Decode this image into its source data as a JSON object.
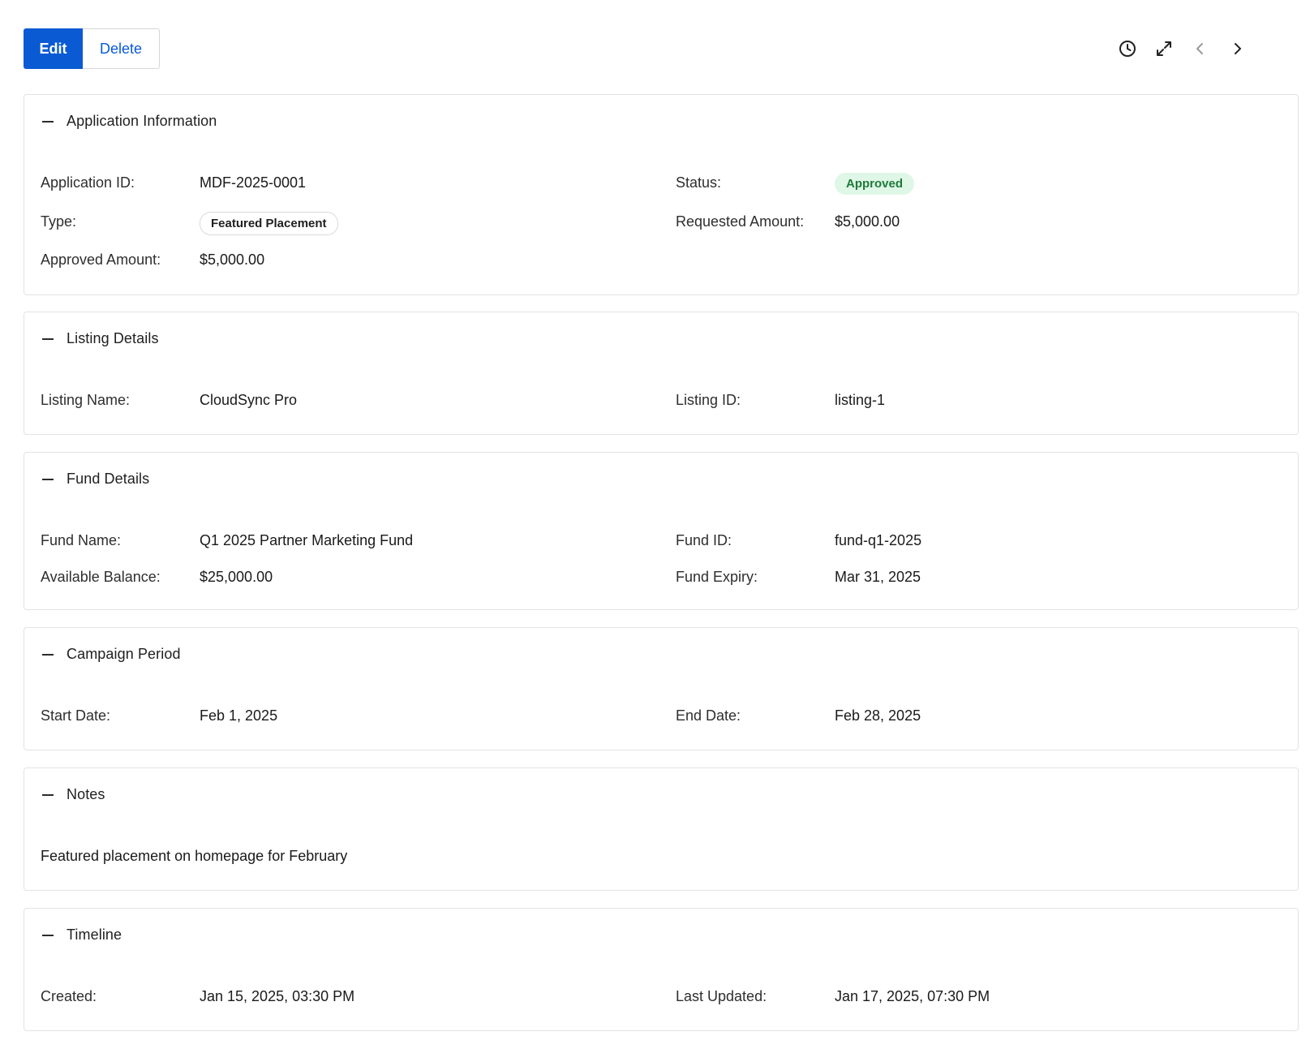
{
  "toolbar": {
    "edit_label": "Edit",
    "delete_label": "Delete",
    "icons": [
      "history-icon",
      "expand-icon",
      "previous-icon",
      "next-icon"
    ]
  },
  "sections": {
    "application": {
      "title": "Application Information",
      "application_id_label": "Application ID:",
      "application_id": "MDF-2025-0001",
      "status_label": "Status:",
      "status": "Approved",
      "type_label": "Type:",
      "type": "Featured Placement",
      "requested_amount_label": "Requested Amount:",
      "requested_amount": "$5,000.00",
      "approved_amount_label": "Approved Amount:",
      "approved_amount": "$5,000.00"
    },
    "listing": {
      "title": "Listing Details",
      "listing_name_label": "Listing Name:",
      "listing_name": "CloudSync Pro",
      "listing_id_label": "Listing ID:",
      "listing_id": "listing-1"
    },
    "fund": {
      "title": "Fund Details",
      "fund_name_label": "Fund Name:",
      "fund_name": "Q1 2025 Partner Marketing Fund",
      "fund_id_label": "Fund ID:",
      "fund_id": "fund-q1-2025",
      "available_balance_label": "Available Balance:",
      "available_balance": "$25,000.00",
      "fund_expiry_label": "Fund Expiry:",
      "fund_expiry": "Mar 31, 2025"
    },
    "campaign": {
      "title": "Campaign Period",
      "start_date_label": "Start Date:",
      "start_date": "Feb 1, 2025",
      "end_date_label": "End Date:",
      "end_date": "Feb 28, 2025"
    },
    "notes": {
      "title": "Notes",
      "text": "Featured placement on homepage for February"
    },
    "timeline": {
      "title": "Timeline",
      "created_label": "Created:",
      "created": "Jan 15, 2025, 03:30 PM",
      "last_updated_label": "Last Updated:",
      "last_updated": "Jan 17, 2025, 07:30 PM"
    }
  },
  "colors": {
    "primary": "#0a5ad4",
    "status_approved_bg": "#dff7e6",
    "status_approved_text": "#1f7a3a",
    "border": "#e3e3e3"
  }
}
